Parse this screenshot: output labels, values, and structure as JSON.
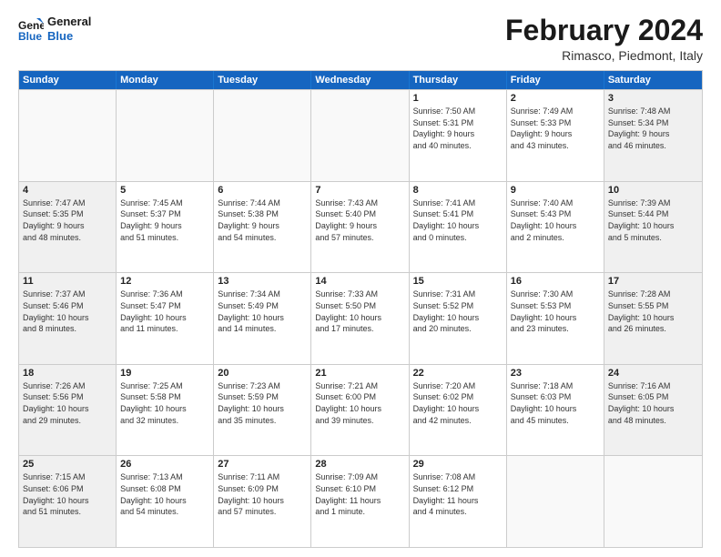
{
  "header": {
    "logo_general": "General",
    "logo_blue": "Blue",
    "title": "February 2024",
    "subtitle": "Rimasco, Piedmont, Italy"
  },
  "weekdays": [
    "Sunday",
    "Monday",
    "Tuesday",
    "Wednesday",
    "Thursday",
    "Friday",
    "Saturday"
  ],
  "rows": [
    [
      {
        "day": "",
        "info": "",
        "empty": true
      },
      {
        "day": "",
        "info": "",
        "empty": true
      },
      {
        "day": "",
        "info": "",
        "empty": true
      },
      {
        "day": "",
        "info": "",
        "empty": true
      },
      {
        "day": "1",
        "info": "Sunrise: 7:50 AM\nSunset: 5:31 PM\nDaylight: 9 hours\nand 40 minutes."
      },
      {
        "day": "2",
        "info": "Sunrise: 7:49 AM\nSunset: 5:33 PM\nDaylight: 9 hours\nand 43 minutes."
      },
      {
        "day": "3",
        "info": "Sunrise: 7:48 AM\nSunset: 5:34 PM\nDaylight: 9 hours\nand 46 minutes."
      }
    ],
    [
      {
        "day": "4",
        "info": "Sunrise: 7:47 AM\nSunset: 5:35 PM\nDaylight: 9 hours\nand 48 minutes."
      },
      {
        "day": "5",
        "info": "Sunrise: 7:45 AM\nSunset: 5:37 PM\nDaylight: 9 hours\nand 51 minutes."
      },
      {
        "day": "6",
        "info": "Sunrise: 7:44 AM\nSunset: 5:38 PM\nDaylight: 9 hours\nand 54 minutes."
      },
      {
        "day": "7",
        "info": "Sunrise: 7:43 AM\nSunset: 5:40 PM\nDaylight: 9 hours\nand 57 minutes."
      },
      {
        "day": "8",
        "info": "Sunrise: 7:41 AM\nSunset: 5:41 PM\nDaylight: 10 hours\nand 0 minutes."
      },
      {
        "day": "9",
        "info": "Sunrise: 7:40 AM\nSunset: 5:43 PM\nDaylight: 10 hours\nand 2 minutes."
      },
      {
        "day": "10",
        "info": "Sunrise: 7:39 AM\nSunset: 5:44 PM\nDaylight: 10 hours\nand 5 minutes."
      }
    ],
    [
      {
        "day": "11",
        "info": "Sunrise: 7:37 AM\nSunset: 5:46 PM\nDaylight: 10 hours\nand 8 minutes."
      },
      {
        "day": "12",
        "info": "Sunrise: 7:36 AM\nSunset: 5:47 PM\nDaylight: 10 hours\nand 11 minutes."
      },
      {
        "day": "13",
        "info": "Sunrise: 7:34 AM\nSunset: 5:49 PM\nDaylight: 10 hours\nand 14 minutes."
      },
      {
        "day": "14",
        "info": "Sunrise: 7:33 AM\nSunset: 5:50 PM\nDaylight: 10 hours\nand 17 minutes."
      },
      {
        "day": "15",
        "info": "Sunrise: 7:31 AM\nSunset: 5:52 PM\nDaylight: 10 hours\nand 20 minutes."
      },
      {
        "day": "16",
        "info": "Sunrise: 7:30 AM\nSunset: 5:53 PM\nDaylight: 10 hours\nand 23 minutes."
      },
      {
        "day": "17",
        "info": "Sunrise: 7:28 AM\nSunset: 5:55 PM\nDaylight: 10 hours\nand 26 minutes."
      }
    ],
    [
      {
        "day": "18",
        "info": "Sunrise: 7:26 AM\nSunset: 5:56 PM\nDaylight: 10 hours\nand 29 minutes."
      },
      {
        "day": "19",
        "info": "Sunrise: 7:25 AM\nSunset: 5:58 PM\nDaylight: 10 hours\nand 32 minutes."
      },
      {
        "day": "20",
        "info": "Sunrise: 7:23 AM\nSunset: 5:59 PM\nDaylight: 10 hours\nand 35 minutes."
      },
      {
        "day": "21",
        "info": "Sunrise: 7:21 AM\nSunset: 6:00 PM\nDaylight: 10 hours\nand 39 minutes."
      },
      {
        "day": "22",
        "info": "Sunrise: 7:20 AM\nSunset: 6:02 PM\nDaylight: 10 hours\nand 42 minutes."
      },
      {
        "day": "23",
        "info": "Sunrise: 7:18 AM\nSunset: 6:03 PM\nDaylight: 10 hours\nand 45 minutes."
      },
      {
        "day": "24",
        "info": "Sunrise: 7:16 AM\nSunset: 6:05 PM\nDaylight: 10 hours\nand 48 minutes."
      }
    ],
    [
      {
        "day": "25",
        "info": "Sunrise: 7:15 AM\nSunset: 6:06 PM\nDaylight: 10 hours\nand 51 minutes."
      },
      {
        "day": "26",
        "info": "Sunrise: 7:13 AM\nSunset: 6:08 PM\nDaylight: 10 hours\nand 54 minutes."
      },
      {
        "day": "27",
        "info": "Sunrise: 7:11 AM\nSunset: 6:09 PM\nDaylight: 10 hours\nand 57 minutes."
      },
      {
        "day": "28",
        "info": "Sunrise: 7:09 AM\nSunset: 6:10 PM\nDaylight: 11 hours\nand 1 minute."
      },
      {
        "day": "29",
        "info": "Sunrise: 7:08 AM\nSunset: 6:12 PM\nDaylight: 11 hours\nand 4 minutes."
      },
      {
        "day": "",
        "info": "",
        "empty": true
      },
      {
        "day": "",
        "info": "",
        "empty": true
      }
    ]
  ]
}
